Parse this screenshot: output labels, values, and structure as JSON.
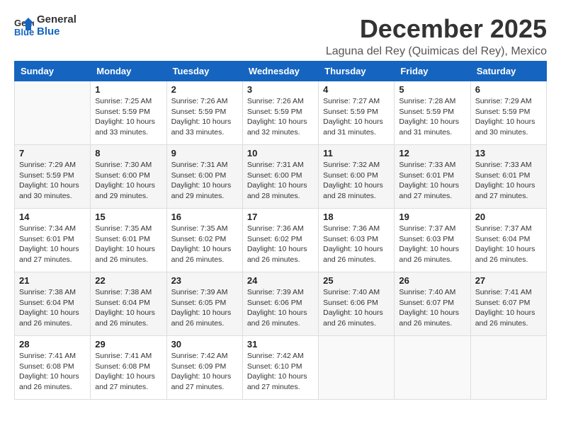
{
  "header": {
    "logo_line1": "General",
    "logo_line2": "Blue",
    "month_title": "December 2025",
    "location": "Laguna del Rey (Quimicas del Rey), Mexico"
  },
  "days_of_week": [
    "Sunday",
    "Monday",
    "Tuesday",
    "Wednesday",
    "Thursday",
    "Friday",
    "Saturday"
  ],
  "weeks": [
    [
      {
        "day": "",
        "info": ""
      },
      {
        "day": "1",
        "info": "Sunrise: 7:25 AM\nSunset: 5:59 PM\nDaylight: 10 hours\nand 33 minutes."
      },
      {
        "day": "2",
        "info": "Sunrise: 7:26 AM\nSunset: 5:59 PM\nDaylight: 10 hours\nand 33 minutes."
      },
      {
        "day": "3",
        "info": "Sunrise: 7:26 AM\nSunset: 5:59 PM\nDaylight: 10 hours\nand 32 minutes."
      },
      {
        "day": "4",
        "info": "Sunrise: 7:27 AM\nSunset: 5:59 PM\nDaylight: 10 hours\nand 31 minutes."
      },
      {
        "day": "5",
        "info": "Sunrise: 7:28 AM\nSunset: 5:59 PM\nDaylight: 10 hours\nand 31 minutes."
      },
      {
        "day": "6",
        "info": "Sunrise: 7:29 AM\nSunset: 5:59 PM\nDaylight: 10 hours\nand 30 minutes."
      }
    ],
    [
      {
        "day": "7",
        "info": "Sunrise: 7:29 AM\nSunset: 5:59 PM\nDaylight: 10 hours\nand 30 minutes."
      },
      {
        "day": "8",
        "info": "Sunrise: 7:30 AM\nSunset: 6:00 PM\nDaylight: 10 hours\nand 29 minutes."
      },
      {
        "day": "9",
        "info": "Sunrise: 7:31 AM\nSunset: 6:00 PM\nDaylight: 10 hours\nand 29 minutes."
      },
      {
        "day": "10",
        "info": "Sunrise: 7:31 AM\nSunset: 6:00 PM\nDaylight: 10 hours\nand 28 minutes."
      },
      {
        "day": "11",
        "info": "Sunrise: 7:32 AM\nSunset: 6:00 PM\nDaylight: 10 hours\nand 28 minutes."
      },
      {
        "day": "12",
        "info": "Sunrise: 7:33 AM\nSunset: 6:01 PM\nDaylight: 10 hours\nand 27 minutes."
      },
      {
        "day": "13",
        "info": "Sunrise: 7:33 AM\nSunset: 6:01 PM\nDaylight: 10 hours\nand 27 minutes."
      }
    ],
    [
      {
        "day": "14",
        "info": "Sunrise: 7:34 AM\nSunset: 6:01 PM\nDaylight: 10 hours\nand 27 minutes."
      },
      {
        "day": "15",
        "info": "Sunrise: 7:35 AM\nSunset: 6:01 PM\nDaylight: 10 hours\nand 26 minutes."
      },
      {
        "day": "16",
        "info": "Sunrise: 7:35 AM\nSunset: 6:02 PM\nDaylight: 10 hours\nand 26 minutes."
      },
      {
        "day": "17",
        "info": "Sunrise: 7:36 AM\nSunset: 6:02 PM\nDaylight: 10 hours\nand 26 minutes."
      },
      {
        "day": "18",
        "info": "Sunrise: 7:36 AM\nSunset: 6:03 PM\nDaylight: 10 hours\nand 26 minutes."
      },
      {
        "day": "19",
        "info": "Sunrise: 7:37 AM\nSunset: 6:03 PM\nDaylight: 10 hours\nand 26 minutes."
      },
      {
        "day": "20",
        "info": "Sunrise: 7:37 AM\nSunset: 6:04 PM\nDaylight: 10 hours\nand 26 minutes."
      }
    ],
    [
      {
        "day": "21",
        "info": "Sunrise: 7:38 AM\nSunset: 6:04 PM\nDaylight: 10 hours\nand 26 minutes."
      },
      {
        "day": "22",
        "info": "Sunrise: 7:38 AM\nSunset: 6:04 PM\nDaylight: 10 hours\nand 26 minutes."
      },
      {
        "day": "23",
        "info": "Sunrise: 7:39 AM\nSunset: 6:05 PM\nDaylight: 10 hours\nand 26 minutes."
      },
      {
        "day": "24",
        "info": "Sunrise: 7:39 AM\nSunset: 6:06 PM\nDaylight: 10 hours\nand 26 minutes."
      },
      {
        "day": "25",
        "info": "Sunrise: 7:40 AM\nSunset: 6:06 PM\nDaylight: 10 hours\nand 26 minutes."
      },
      {
        "day": "26",
        "info": "Sunrise: 7:40 AM\nSunset: 6:07 PM\nDaylight: 10 hours\nand 26 minutes."
      },
      {
        "day": "27",
        "info": "Sunrise: 7:41 AM\nSunset: 6:07 PM\nDaylight: 10 hours\nand 26 minutes."
      }
    ],
    [
      {
        "day": "28",
        "info": "Sunrise: 7:41 AM\nSunset: 6:08 PM\nDaylight: 10 hours\nand 26 minutes."
      },
      {
        "day": "29",
        "info": "Sunrise: 7:41 AM\nSunset: 6:08 PM\nDaylight: 10 hours\nand 27 minutes."
      },
      {
        "day": "30",
        "info": "Sunrise: 7:42 AM\nSunset: 6:09 PM\nDaylight: 10 hours\nand 27 minutes."
      },
      {
        "day": "31",
        "info": "Sunrise: 7:42 AM\nSunset: 6:10 PM\nDaylight: 10 hours\nand 27 minutes."
      },
      {
        "day": "",
        "info": ""
      },
      {
        "day": "",
        "info": ""
      },
      {
        "day": "",
        "info": ""
      }
    ]
  ]
}
